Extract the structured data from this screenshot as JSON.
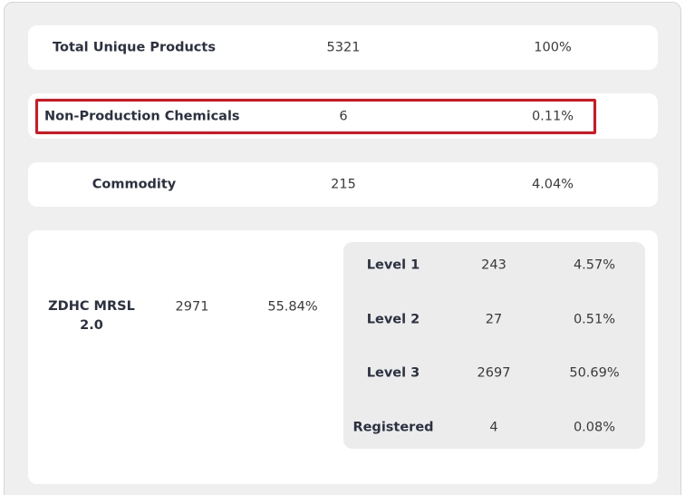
{
  "summary_rows": [
    {
      "label": "Total Unique Products",
      "count": "5321",
      "percent": "100%"
    },
    {
      "label": "Non-Production Chemicals",
      "count": "6",
      "percent": "0.11%",
      "highlighted": true
    },
    {
      "label": "Commodity",
      "count": "215",
      "percent": "4.04%"
    }
  ],
  "zdhc": {
    "label": "ZDHC MRSL 2.0",
    "count": "2971",
    "percent": "55.84%",
    "levels": [
      {
        "label": "Level 1",
        "count": "243",
        "percent": "4.57%"
      },
      {
        "label": "Level 2",
        "count": "27",
        "percent": "0.51%"
      },
      {
        "label": "Level 3",
        "count": "2697",
        "percent": "50.69%"
      },
      {
        "label": "Registered",
        "count": "4",
        "percent": "0.08%"
      }
    ]
  },
  "colors": {
    "panel_background": "#efefef",
    "card_background": "#ffffff",
    "highlight_border": "#e0101c",
    "label_text": "#2b3140"
  }
}
